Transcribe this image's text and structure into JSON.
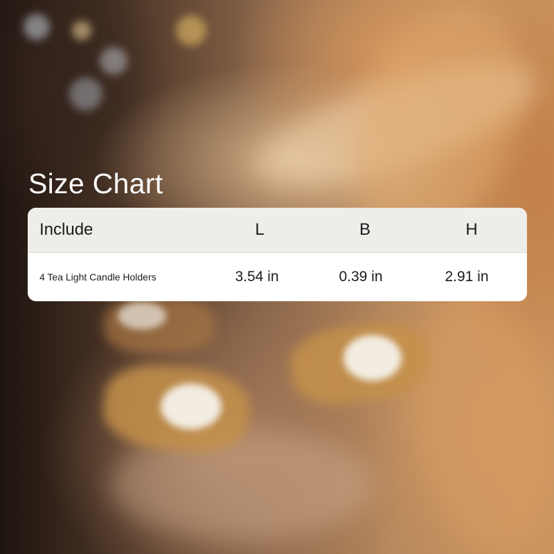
{
  "title": "Size Chart",
  "table": {
    "headers": {
      "name": "Include",
      "length": "L",
      "breadth": "B",
      "height": "H"
    },
    "rows": [
      {
        "name": "4 Tea Light Candle Holders",
        "length": "3.54 in",
        "breadth": "0.39 in",
        "height": "2.91 in"
      }
    ]
  },
  "colors": {
    "card_background": "#ffffff",
    "header_background": "#efedea",
    "title_text": "#ffffff",
    "body_text": "#1b1b1b"
  }
}
